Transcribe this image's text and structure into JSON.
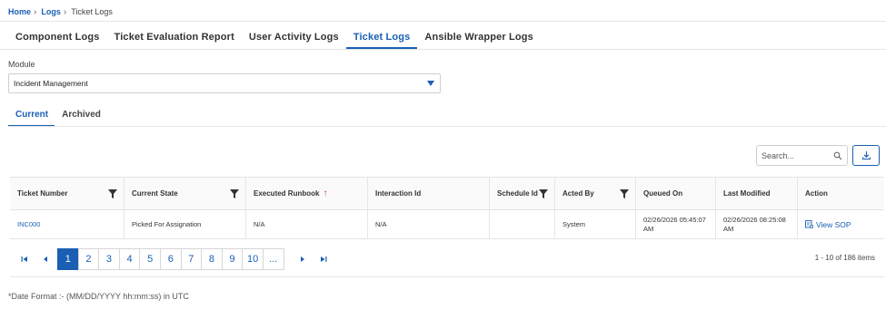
{
  "breadcrumb": {
    "home": "Home",
    "logs": "Logs",
    "current": "Ticket Logs"
  },
  "tabs": [
    "Component Logs",
    "Ticket Evaluation Report",
    "User Activity Logs",
    "Ticket Logs",
    "Ansible Wrapper Logs"
  ],
  "active_tab": "Ticket Logs",
  "module": {
    "label": "Module",
    "selected": "Incident Management"
  },
  "subtabs": [
    "Current",
    "Archived"
  ],
  "active_subtab": "Current",
  "search": {
    "placeholder": "Search..."
  },
  "table": {
    "columns": [
      "Ticket Number",
      "Current State",
      "Executed Runbook",
      "Interaction Id",
      "Schedule Id",
      "Acted By",
      "Queued On",
      "Last Modified",
      "Action"
    ],
    "rows": [
      {
        "ticket_number": "INC000",
        "current_state": "Picked For Assignation",
        "executed_runbook": "N/A",
        "interaction_id": "N/A",
        "schedule_id": "",
        "acted_by": "System",
        "queued_on": "02/26/2026 05:45:07 AM",
        "last_modified": "02/26/2026 08:25:08 AM",
        "action": "View SOP"
      }
    ]
  },
  "pager": {
    "pages": [
      "1",
      "2",
      "3",
      "4",
      "5",
      "6",
      "7",
      "8",
      "9",
      "10",
      "..."
    ],
    "active_page": "1",
    "info": "1 - 10 of 186 items"
  },
  "date_note": "*Date Format :- (MM/DD/YYYY hh:mm:ss) in UTC",
  "colors": {
    "accent": "#1a5fb4",
    "sort_arrow": "#d63a3a"
  }
}
